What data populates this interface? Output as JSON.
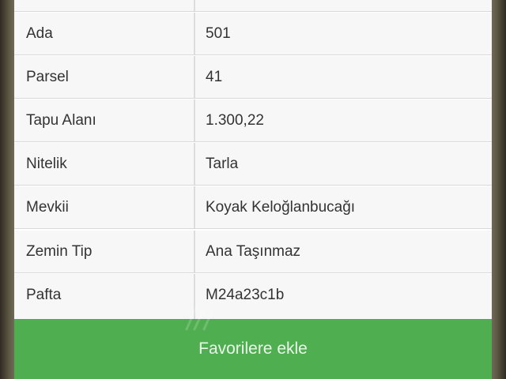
{
  "colors": {
    "button_bg": "#4fae4f",
    "button_text": "#eaf6ea",
    "row_bg": "#f7f7f7",
    "text": "#333333"
  },
  "details": {
    "rows": [
      {
        "label": "",
        "value": ""
      },
      {
        "label": "Ada",
        "value": "501"
      },
      {
        "label": "Parsel",
        "value": "41"
      },
      {
        "label": "Tapu Alanı",
        "value": "1.300,22"
      },
      {
        "label": "Nitelik",
        "value": "Tarla"
      },
      {
        "label": "Mevkii",
        "value": "Koyak Keloğlanbucağı"
      },
      {
        "label": "Zemin Tip",
        "value": "Ana Taşınmaz"
      },
      {
        "label": "Pafta",
        "value": "M24a23c1b"
      }
    ]
  },
  "actions": {
    "favorite_label": "Favorilere ekle"
  }
}
